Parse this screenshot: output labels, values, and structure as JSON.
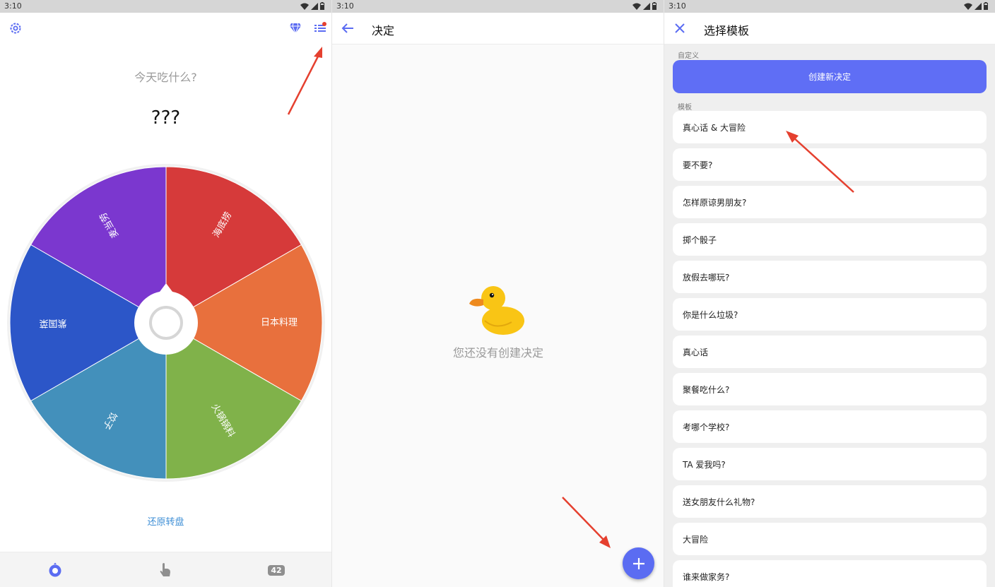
{
  "status": {
    "time": "3:10"
  },
  "wheel_screen": {
    "question": "今天吃什么?",
    "answer": "???",
    "reset_label": "还原转盘",
    "segments": [
      {
        "label": "麦当劳",
        "color": "#7b37cf"
      },
      {
        "label": "海底捞",
        "color": "#d63a3a"
      },
      {
        "label": "日本料理",
        "color": "#e8703d"
      },
      {
        "label": "火锅锅料",
        "color": "#80b24a"
      },
      {
        "label": "饺子",
        "color": "#4390bb"
      },
      {
        "label": "紫国菜",
        "color": "#2c56c8"
      }
    ],
    "nav_badge": "42"
  },
  "decisions_screen": {
    "title": "决定",
    "empty_text": "您还没有创建决定"
  },
  "template_screen": {
    "title": "选择模板",
    "custom_section": "自定义",
    "create_label": "创建新决定",
    "template_section": "模板",
    "templates": [
      "真心话 & 大冒险",
      "要不要?",
      "怎样原谅男朋友?",
      "掷个骰子",
      "放假去哪玩?",
      "你是什么垃圾?",
      "真心话",
      "聚餐吃什么?",
      "考哪个学校?",
      "TA 爱我吗?",
      "送女朋友什么礼物?",
      "大冒险",
      "谁来做家务?"
    ]
  },
  "colors": {
    "accent": "#5b6cf2",
    "annotation_arrow": "#e5402f"
  }
}
